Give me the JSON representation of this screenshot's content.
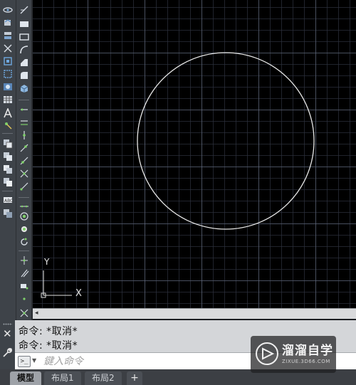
{
  "canvas": {
    "ucs": {
      "x_label": "X",
      "y_label": "Y"
    },
    "circle_color": "#e8e8e8",
    "background_color": "#000000"
  },
  "toolbar_left": {
    "buttons": [
      "orbit-icon",
      "undo-icon",
      "layers-icon",
      "line-icon",
      "region-icon",
      "select-window-icon",
      "zoom-icon",
      "table-icon",
      "text-icon",
      "point-icon",
      "copy-icon",
      "move-icon",
      "stack-icon",
      "palette-icon",
      "display-icon",
      "block-icon"
    ]
  },
  "toolbar_right": {
    "buttons": [
      "construction-line-icon",
      "rectangle-icon",
      "polygon-icon",
      "arc-icon",
      "fillet-icon",
      "chamfer-icon",
      "box-3d-icon",
      "dimension-icon",
      "offset-icon",
      "snap-icon",
      "trim-icon",
      "extend-icon",
      "break-icon",
      "join-icon",
      "center-mark-icon",
      "node-icon",
      "rotate-icon",
      "parallel-icon",
      "mirror-icon",
      "stretch-icon",
      "explode-icon"
    ]
  },
  "command": {
    "history": [
      "命令: *取消*",
      "命令: *取消*"
    ],
    "placeholder": "鍵入命令",
    "prompt_symbol": ">_"
  },
  "tabs": [
    {
      "label": "模型",
      "active": true
    },
    {
      "label": "布局1",
      "active": false
    },
    {
      "label": "布局2",
      "active": false
    }
  ],
  "tab_add_label": "+",
  "watermark": {
    "title": "溜溜自学",
    "subtitle": "ZIXUE.3D66.COM"
  }
}
